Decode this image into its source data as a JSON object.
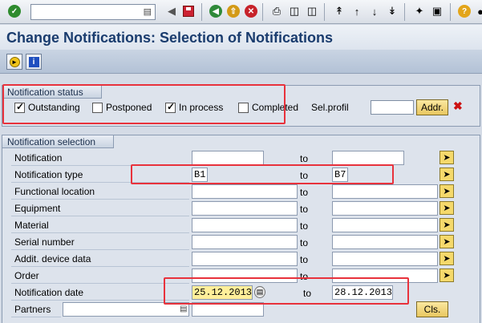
{
  "toolbar": {
    "command_field_value": "",
    "icons": [
      "enter-icon",
      "command-field-dropdown-icon",
      "back-arrow-icon",
      "save-icon",
      "back-icon",
      "exit-icon",
      "cancel-icon",
      "print-icon",
      "find-icon",
      "find-next-icon",
      "first-page-icon",
      "previous-page-icon",
      "next-page-icon",
      "last-page-icon",
      "create-session-icon",
      "shortcut-icon",
      "help-icon",
      "customize-layout-icon"
    ]
  },
  "page": {
    "title": "Change Notifications: Selection of Notifications"
  },
  "app_toolbar": {
    "buttons": [
      "execute-icon",
      "info-icon"
    ]
  },
  "status_group": {
    "header": "Notification status",
    "options": [
      {
        "label": "Outstanding",
        "checked": true
      },
      {
        "label": "Postponed",
        "checked": false
      },
      {
        "label": "In process",
        "checked": true
      },
      {
        "label": "Completed",
        "checked": false
      }
    ],
    "sel_profil_label": "Sel.profil",
    "sel_profil_value": "",
    "addr_button": "Addr."
  },
  "selection_group": {
    "header": "Notification selection",
    "to_label": "to",
    "rows": [
      {
        "label": "Notification",
        "from": "",
        "to": ""
      },
      {
        "label": "Notification type",
        "from": "B1",
        "to": "B7"
      },
      {
        "label": "Functional location",
        "from": "",
        "to": ""
      },
      {
        "label": "Equipment",
        "from": "",
        "to": ""
      },
      {
        "label": "Material",
        "from": "",
        "to": ""
      },
      {
        "label": "Serial number",
        "from": "",
        "to": ""
      },
      {
        "label": "Addit. device data",
        "from": "",
        "to": ""
      },
      {
        "label": "Order",
        "from": "",
        "to": ""
      },
      {
        "label": "Notification date",
        "from": "25.12.2013",
        "to": "28.12.2013"
      }
    ],
    "partners_label": "Partners",
    "partners_value": "",
    "partners_value2": "",
    "cls_button": "Cls."
  },
  "colors": {
    "highlight": "#e8323c",
    "title": "#1a3c6e",
    "button": "#f5d96b"
  }
}
